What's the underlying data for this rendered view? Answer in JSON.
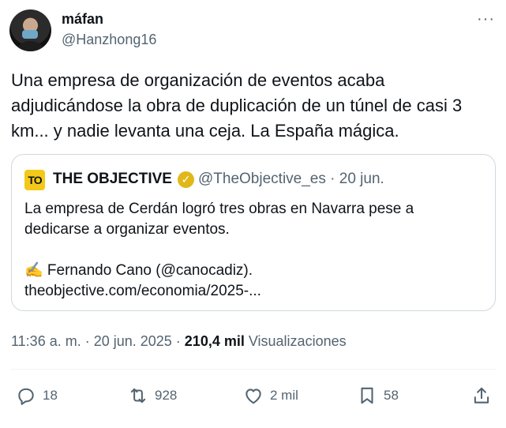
{
  "author": {
    "name": "máfan",
    "handle": "@Hanzhong16"
  },
  "more_label": "···",
  "tweet": {
    "text": "Una empresa de organización de eventos acaba adjudicándose la obra de duplicación de un túnel de casi 3 km... y nadie levanta una ceja. La España mágica."
  },
  "quote": {
    "logo_text": "TO",
    "name": "THE OBJECTIVE",
    "verified_mark": "✓",
    "handle_date": "@TheObjective_es · 20 jun.",
    "text": "La empresa de Cerdán logró tres obras en Navarra pese a dedicarse a organizar eventos.\n\n✍️ Fernando Cano (@canocadiz).\ntheobjective.com/economia/2025-..."
  },
  "meta": {
    "time_date": "11:36 a. m. · 20 jun. 2025 · ",
    "views_count": "210,4 mil",
    "views_label": " Visualizaciones"
  },
  "actions": {
    "replies": "18",
    "retweets": "928",
    "likes": "2 mil",
    "bookmarks": "58"
  },
  "icons": [
    "reply-icon",
    "retweet-icon",
    "like-icon",
    "bookmark-icon",
    "share-icon",
    "verified-icon",
    "more-icon"
  ]
}
